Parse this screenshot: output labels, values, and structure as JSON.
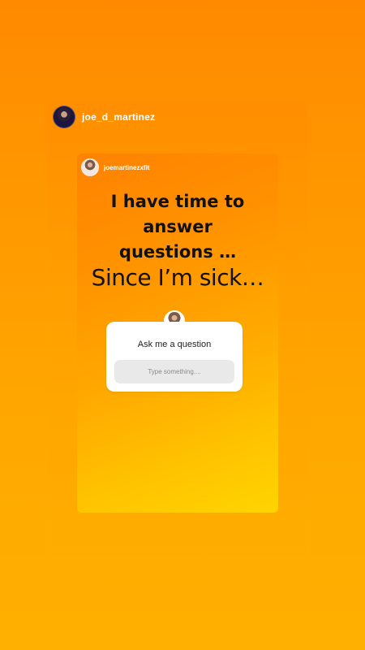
{
  "story": {
    "account": "joe_d_martinez",
    "shared_post": {
      "username": "joemartinezxfit",
      "headline": "I have time to answer\nquestions …",
      "subtext": "Since I’m sick…"
    },
    "question_sticker": {
      "prompt": "Ask me a question",
      "placeholder": "Type something...."
    }
  },
  "colors": {
    "background_top": "#ff8a00",
    "background_bottom": "#ffb000",
    "inner_gradient_start": "#ff8200",
    "inner_gradient_end": "#ffd400",
    "text_dark": "#111111",
    "sticker_bg": "#ffffff",
    "input_bg": "#e9e9e9"
  },
  "icons": {
    "main_avatar": "profile-avatar",
    "inner_avatar": "profile-avatar",
    "sticker_avatar": "profile-avatar"
  }
}
